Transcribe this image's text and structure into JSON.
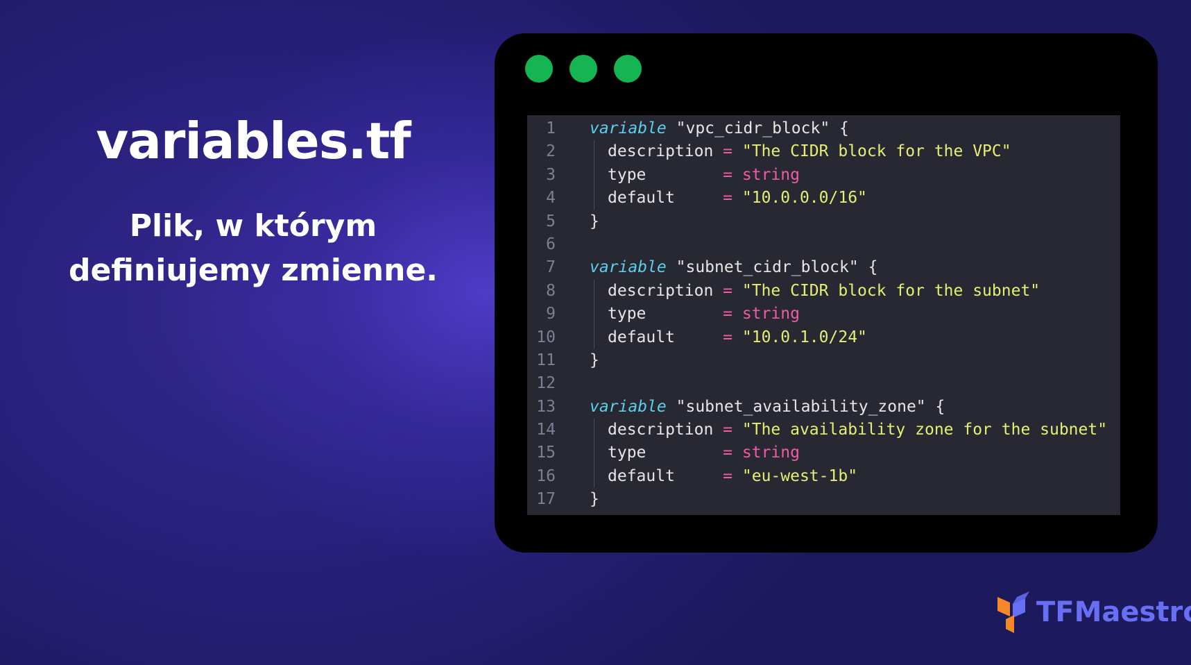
{
  "slide": {
    "title": "variables.tf",
    "subtitle_lines": [
      "Plik, w którym",
      "definiujemy zmienne."
    ]
  },
  "window": {
    "traffic_lights": [
      "green-dot",
      "green-dot",
      "green-dot"
    ],
    "traffic_light_color": "#16b553"
  },
  "code": {
    "lines": [
      {
        "n": "1",
        "tokens": [
          {
            "t": "kw",
            "v": "variable"
          },
          {
            "t": "plain",
            "v": " \"vpc_cidr_block\" {"
          }
        ]
      },
      {
        "n": "2",
        "indent": true,
        "tokens": [
          {
            "t": "plain",
            "v": "description "
          },
          {
            "t": "eq",
            "v": "="
          },
          {
            "t": "str",
            "v": " \"The CIDR block for the VPC\""
          }
        ]
      },
      {
        "n": "3",
        "indent": true,
        "tokens": [
          {
            "t": "plain",
            "v": "type        "
          },
          {
            "t": "eq",
            "v": "="
          },
          {
            "t": "typ",
            "v": " string"
          }
        ]
      },
      {
        "n": "4",
        "indent": true,
        "tokens": [
          {
            "t": "plain",
            "v": "default     "
          },
          {
            "t": "eq",
            "v": "="
          },
          {
            "t": "str",
            "v": " \"10.0.0.0/16\""
          }
        ]
      },
      {
        "n": "5",
        "tokens": [
          {
            "t": "plain",
            "v": "}"
          }
        ]
      },
      {
        "n": "6",
        "tokens": []
      },
      {
        "n": "7",
        "tokens": [
          {
            "t": "kw",
            "v": "variable"
          },
          {
            "t": "plain",
            "v": " \"subnet_cidr_block\" {"
          }
        ]
      },
      {
        "n": "8",
        "indent": true,
        "tokens": [
          {
            "t": "plain",
            "v": "description "
          },
          {
            "t": "eq",
            "v": "="
          },
          {
            "t": "str",
            "v": " \"The CIDR block for the subnet\""
          }
        ]
      },
      {
        "n": "9",
        "indent": true,
        "tokens": [
          {
            "t": "plain",
            "v": "type        "
          },
          {
            "t": "eq",
            "v": "="
          },
          {
            "t": "typ",
            "v": " string"
          }
        ]
      },
      {
        "n": "10",
        "indent": true,
        "tokens": [
          {
            "t": "plain",
            "v": "default     "
          },
          {
            "t": "eq",
            "v": "="
          },
          {
            "t": "str",
            "v": " \"10.0.1.0/24\""
          }
        ]
      },
      {
        "n": "11",
        "tokens": [
          {
            "t": "plain",
            "v": "}"
          }
        ]
      },
      {
        "n": "12",
        "tokens": []
      },
      {
        "n": "13",
        "tokens": [
          {
            "t": "kw",
            "v": "variable"
          },
          {
            "t": "plain",
            "v": " \"subnet_availability_zone\" {"
          }
        ]
      },
      {
        "n": "14",
        "indent": true,
        "tokens": [
          {
            "t": "plain",
            "v": "description "
          },
          {
            "t": "eq",
            "v": "="
          },
          {
            "t": "str",
            "v": " \"The availability zone for the subnet\""
          }
        ]
      },
      {
        "n": "15",
        "indent": true,
        "tokens": [
          {
            "t": "plain",
            "v": "type        "
          },
          {
            "t": "eq",
            "v": "="
          },
          {
            "t": "typ",
            "v": " string"
          }
        ]
      },
      {
        "n": "16",
        "indent": true,
        "tokens": [
          {
            "t": "plain",
            "v": "default     "
          },
          {
            "t": "eq",
            "v": "="
          },
          {
            "t": "str",
            "v": " \"eu-west-1b\""
          }
        ]
      },
      {
        "n": "17",
        "tokens": [
          {
            "t": "plain",
            "v": "}"
          }
        ]
      }
    ],
    "colors": {
      "keyword": "#5ad0ec",
      "string": "#e6ee76",
      "operator": "#f15ca8",
      "type": "#f15ca8",
      "plain": "#e6e6e6",
      "line_number": "#7b8094",
      "background": "#272831"
    }
  },
  "brand": {
    "logo_icon": "tfmaestro-logo-icon",
    "name": "TFMaestro",
    "text_color": "#6770f5",
    "mark_color": "#f5892a"
  }
}
